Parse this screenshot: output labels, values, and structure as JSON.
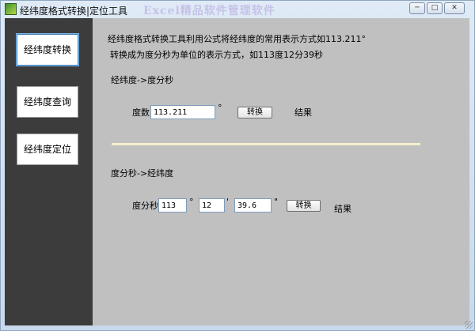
{
  "window": {
    "title": "经纬度格式转换|定位工具",
    "watermark": "Excel精品软件管理软件",
    "minimize_glyph": "─",
    "maximize_glyph": "□",
    "close_glyph": "✕"
  },
  "sidebar": {
    "items": [
      {
        "label": "经纬度转换",
        "active": true
      },
      {
        "label": "经纬度查询"
      },
      {
        "label": "经纬度定位"
      }
    ]
  },
  "main": {
    "description_line1": "经纬度格式转换工具利用公式将经纬度的常用表示方式如113.211°",
    "description_line2": "转换成为度分秒为单位的表示方式，如113度12分39秒",
    "section1": {
      "title": "经纬度->度分秒",
      "degree_label": "度数",
      "degree_value": "113.211",
      "degree_unit": "°",
      "convert_label": "转换",
      "result_label": "结果"
    },
    "section2": {
      "title": "度分秒->经纬度",
      "dms_label": "度分秒",
      "degrees_value": "113",
      "degrees_unit": "°",
      "minutes_value": "12",
      "minutes_unit": "'",
      "seconds_value": "39.6",
      "seconds_unit": "\"",
      "convert_label": "转换",
      "result_label": "结果"
    }
  },
  "colors": {
    "sidebar_bg": "#3c3c3c",
    "content_bg": "#c0c0c0",
    "divider": "#f3f0cc"
  }
}
